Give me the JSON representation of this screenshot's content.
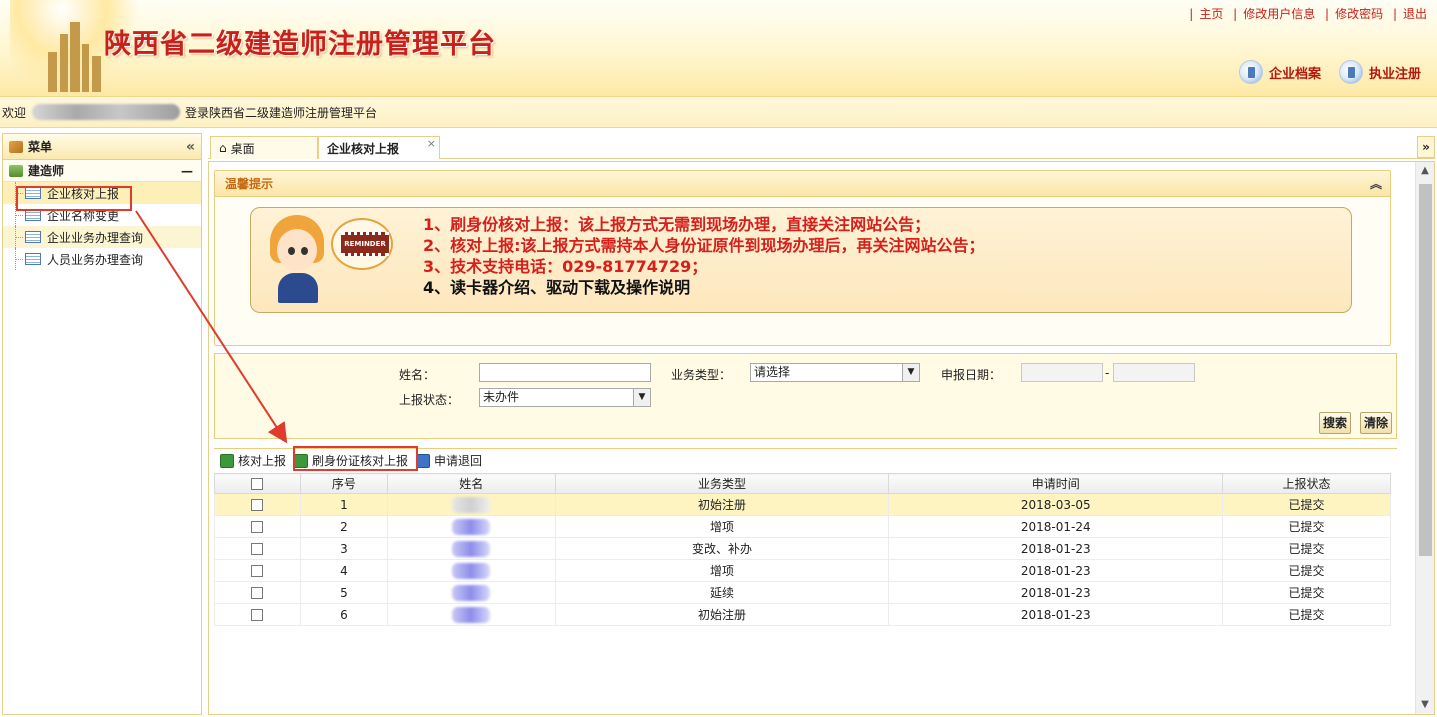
{
  "header": {
    "site_title": "陕西省二级建造师注册管理平台",
    "top_links": [
      "主页",
      "修改用户信息",
      "修改密码",
      "退出"
    ],
    "quick_links": [
      {
        "label": "企业档案",
        "icon": "building-icon"
      },
      {
        "label": "执业注册",
        "icon": "building-icon"
      }
    ]
  },
  "welcome": {
    "prefix": "欢迎",
    "suffix": "登录陕西省二级建造师注册管理平台"
  },
  "sidebar": {
    "title": "菜单",
    "collapse_icon": "double-chevron-left-icon",
    "group_title": "建造师",
    "group_toggle": "—",
    "items": [
      {
        "label": "企业核对上报"
      },
      {
        "label": "企业名称变更"
      },
      {
        "label": "企业业务办理查询"
      },
      {
        "label": "人员业务办理查询"
      }
    ]
  },
  "tabs": {
    "items": [
      {
        "label": "桌面",
        "icon": "home-icon"
      },
      {
        "label": "企业核对上报",
        "close": "×"
      }
    ],
    "menu_icon": "double-chevron-down-icon"
  },
  "notice": {
    "title": "温馨提示",
    "toggle_icon": "double-chevron-up-icon",
    "image_text": "REMINDER",
    "lines": [
      "1、刷身份核对上报：该上报方式无需到现场办理，直接关注网站公告；",
      "2、核对上报:该上报方式需持本人身份证原件到现场办理后，再关注网站公告；",
      "3、技术支持电话：029-81774729；",
      "4、读卡器介绍、驱动下载及操作说明"
    ]
  },
  "search": {
    "name_label": "姓名：",
    "name_value": "",
    "biz_type_label": "业务类型：",
    "biz_type_value": "请选择",
    "date_label": "申报日期：",
    "date_from": "",
    "date_sep": "-",
    "date_to": "",
    "status_label": "上报状态：",
    "status_value": "未办件",
    "search_button": "搜索",
    "clear_button": "清除"
  },
  "toolbar": {
    "items": [
      {
        "label": "核对上报"
      },
      {
        "label": "刷身份证核对上报"
      },
      {
        "label": "申请退回"
      }
    ]
  },
  "table": {
    "headers": [
      "序号",
      "姓名",
      "业务类型",
      "申请时间",
      "上报状态"
    ],
    "rows": [
      {
        "no": "1",
        "type": "初始注册",
        "date": "2018-03-05",
        "status": "已提交"
      },
      {
        "no": "2",
        "type": "增项",
        "date": "2018-01-24",
        "status": "已提交"
      },
      {
        "no": "3",
        "type": "变改、补办",
        "date": "2018-01-23",
        "status": "已提交"
      },
      {
        "no": "4",
        "type": "增项",
        "date": "2018-01-23",
        "status": "已提交"
      },
      {
        "no": "5",
        "type": "延续",
        "date": "2018-01-23",
        "status": "已提交"
      },
      {
        "no": "6",
        "type": "初始注册",
        "date": "2018-01-23",
        "status": "已提交"
      }
    ]
  },
  "colors": {
    "brand_red": "#c8201b",
    "highlight_red": "#e03b2c",
    "header_gold": "#fde9a6"
  }
}
